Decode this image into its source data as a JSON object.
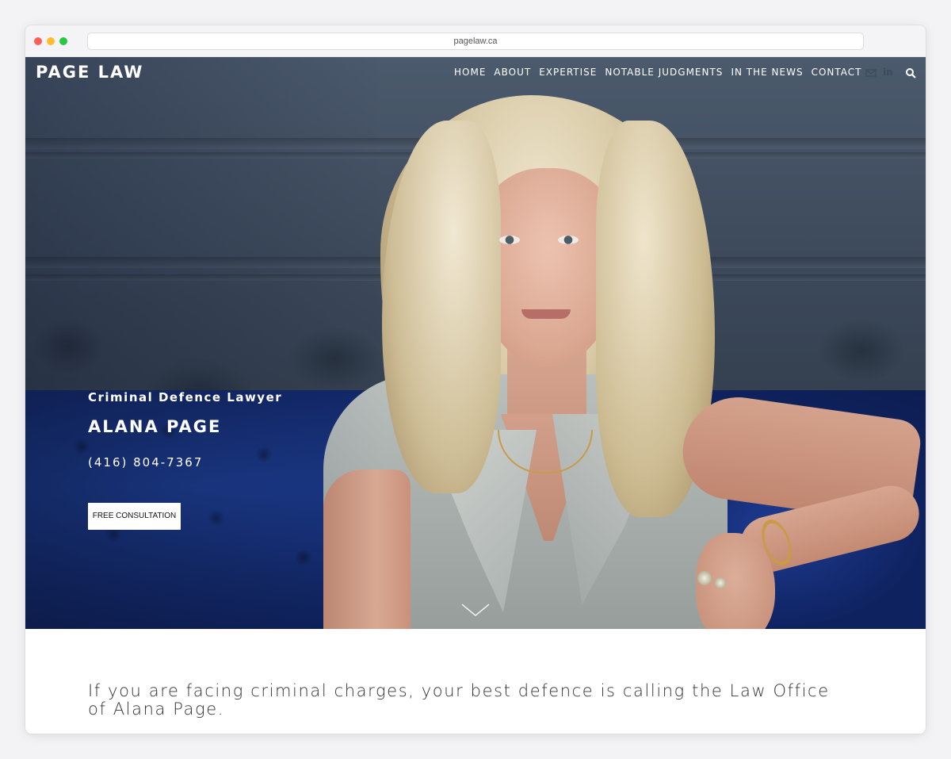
{
  "browser": {
    "url": "pagelaw.ca"
  },
  "header": {
    "logo": "PAGE LAW",
    "nav": [
      "HOME",
      "ABOUT",
      "EXPERTISE",
      "NOTABLE JUDGMENTS",
      "IN THE NEWS",
      "CONTACT"
    ],
    "icons": [
      "mail-icon",
      "linkedin-icon",
      "search-icon"
    ],
    "linkedin_text": "in"
  },
  "hero": {
    "subtitle": "Criminal Defence Lawyer",
    "name": "ALANA PAGE",
    "phone": "(416) 804-7367",
    "cta_label": "FREE CONSULTATION"
  },
  "content": {
    "intro": "If you are facing criminal charges, your best defence is calling the Law Office of Alana Page."
  },
  "colors": {
    "sofa": "#13296a",
    "wall": "#3d4a5c",
    "text_dark": "#333333"
  }
}
